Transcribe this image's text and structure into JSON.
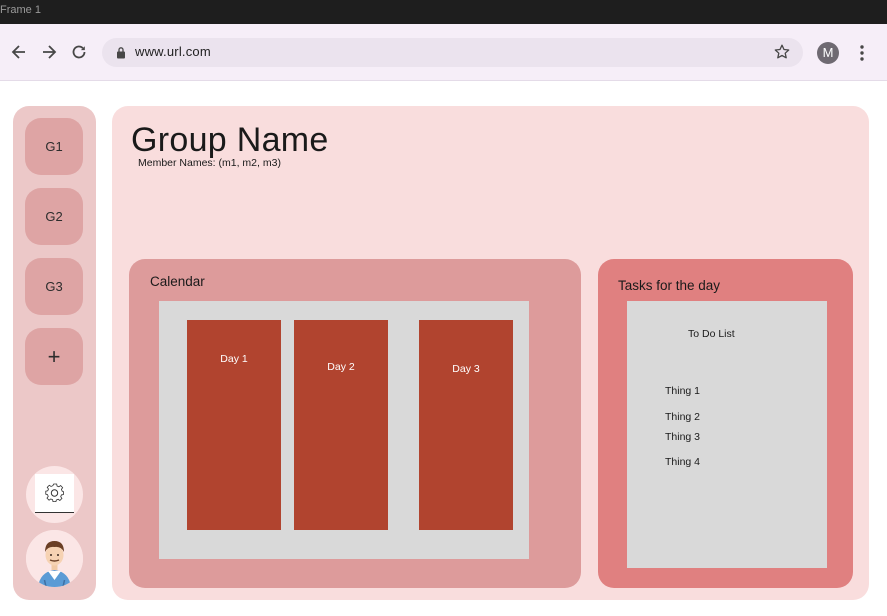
{
  "frame": {
    "title": "Frame 1"
  },
  "browser": {
    "url": "www.url.com",
    "profile_initial": "M",
    "icons": [
      "back-arrow-icon",
      "forward-arrow-icon",
      "reload-icon",
      "lock-icon",
      "star-icon",
      "more-vert-icon"
    ]
  },
  "sidebar": {
    "groups": [
      {
        "label": "G1"
      },
      {
        "label": "G2"
      },
      {
        "label": "G3"
      }
    ],
    "add_label": "+",
    "settings_icon": "gear-icon",
    "profile_icon": "user-avatar"
  },
  "main": {
    "group_name": "Group Name",
    "member_names": "Member Names: (m1, m2, m3)",
    "calendar": {
      "title": "Calendar",
      "days": [
        {
          "label": "Day 1"
        },
        {
          "label": "Day 2"
        },
        {
          "label": "Day 3"
        }
      ]
    },
    "tasks": {
      "title": "Tasks for the day",
      "list_title": "To Do List",
      "items": [
        {
          "label": "Thing 1"
        },
        {
          "label": "Thing 2"
        },
        {
          "label": "Thing 3"
        },
        {
          "label": "Thing 4"
        }
      ]
    }
  },
  "colors": {
    "sidebar_bg": "#ecc8c8",
    "group_button": "#dea4a4",
    "main_bg": "#f9dddd",
    "calendar_card": "#dd9b9b",
    "tasks_card": "#e08080",
    "day_column": "#b1442f",
    "content_gray": "#d9d9d9"
  }
}
